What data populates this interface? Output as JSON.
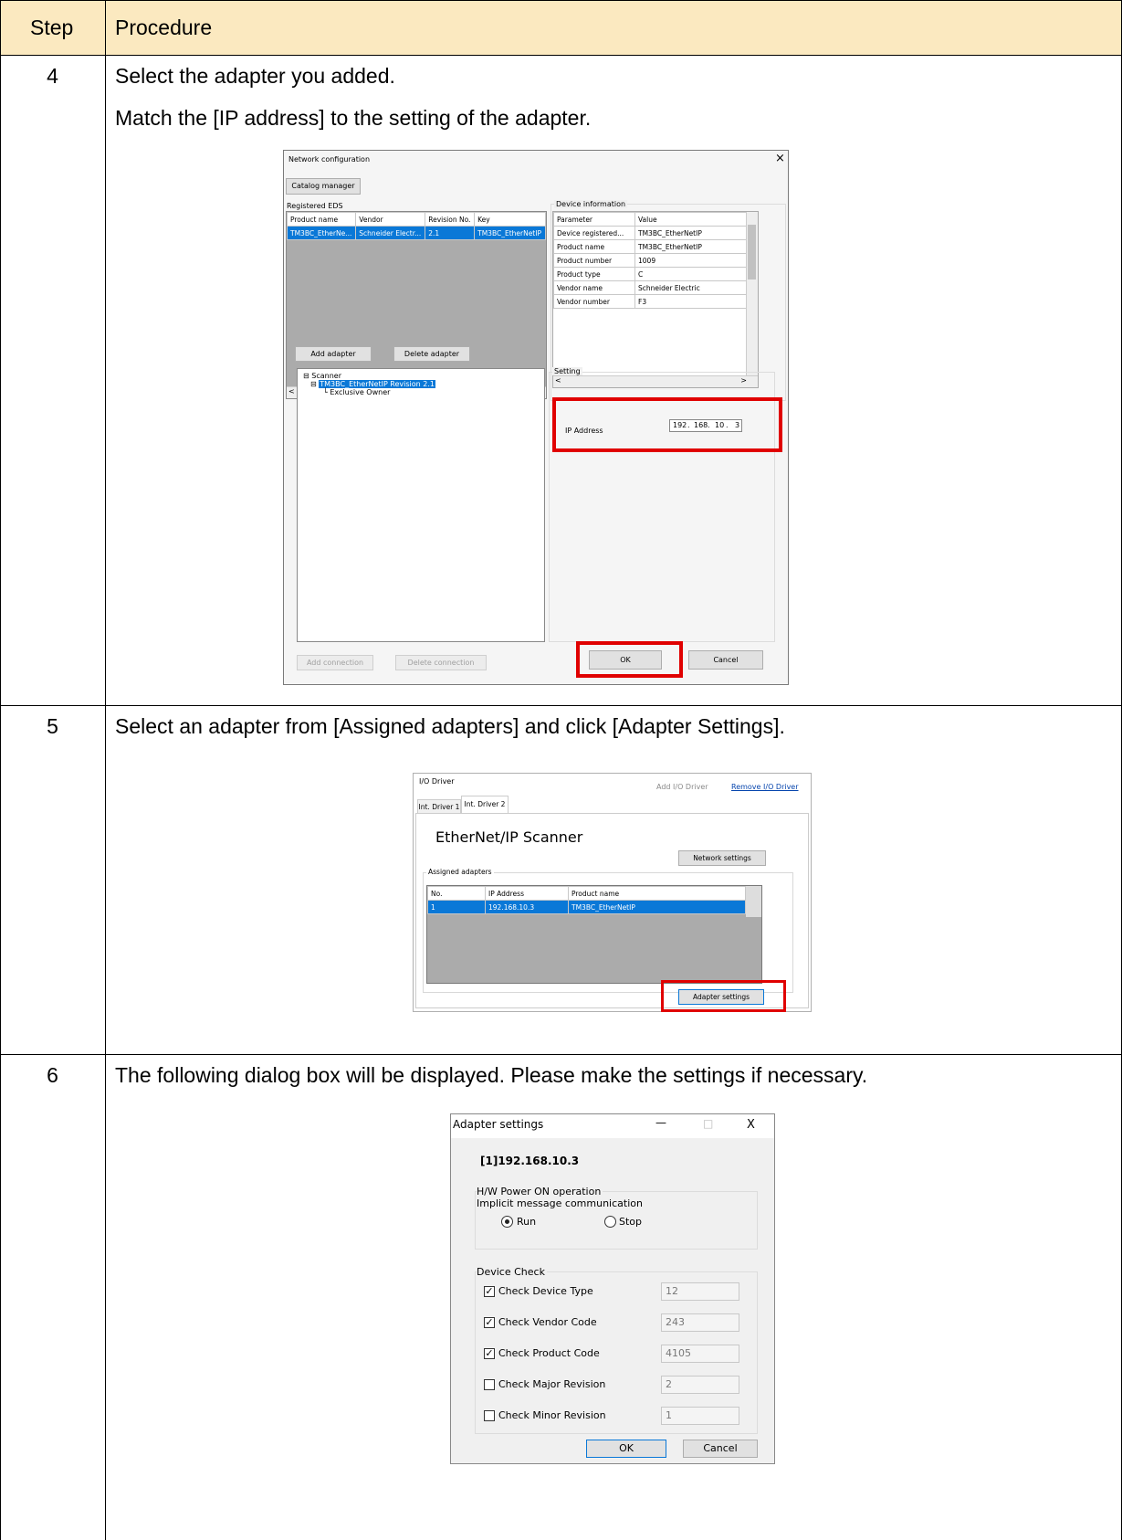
{
  "table": {
    "header": {
      "step": "Step",
      "procedure": "Procedure"
    },
    "rows": [
      {
        "step": "4",
        "lines": [
          "Select the adapter you added.",
          "Match the [IP address] to the setting of the adapter."
        ]
      },
      {
        "step": "5",
        "lines": [
          "Select an adapter from [Assigned adapters] and click [Adapter Settings]."
        ]
      },
      {
        "step": "6",
        "lines": [
          "The following dialog box will be displayed. Please make the settings if necessary."
        ]
      }
    ],
    "header_color": "#fbe9c0"
  },
  "network_config": {
    "title": "Network configuration",
    "close": "×",
    "catalog_manager": "Catalog manager",
    "registered_eds": "Registered EDS",
    "eds_columns": [
      "Product name",
      "Vendor",
      "Revision No.",
      "Key"
    ],
    "eds_row": [
      "TM3BC_EtherNe...",
      "Schneider Electr...",
      "2.1",
      "TM3BC_EtherNetIP"
    ],
    "device_information": "Device information",
    "device_columns": [
      "Parameter",
      "Value"
    ],
    "device_rows": [
      [
        "Device registered...",
        "TM3BC_EtherNetIP"
      ],
      [
        "Product name",
        "TM3BC_EtherNetIP"
      ],
      [
        "Product number",
        "1009"
      ],
      [
        "Product type",
        "C"
      ],
      [
        "Vendor name",
        "Schneider Electric"
      ],
      [
        "Vendor number",
        "F3"
      ]
    ],
    "add_adapter": "Add adapter",
    "delete_adapter": "Delete adapter",
    "setting": "Setting",
    "tree": {
      "root": "Scanner",
      "child": "TM3BC_EtherNetIP Revision 2.1",
      "grandchild": "Exclusive Owner"
    },
    "ip_label": "IP Address",
    "ip_octets": [
      "192",
      "168",
      "10",
      "3"
    ],
    "add_connection": "Add connection",
    "delete_connection": "Delete connection",
    "ok": "OK",
    "cancel": "Cancel"
  },
  "io_driver": {
    "title": "I/O Driver",
    "add_driver": "Add I/O Driver",
    "remove_driver": "Remove I/O Driver",
    "tabs": [
      "Int. Driver 1",
      "Int. Driver 2"
    ],
    "heading": "EtherNet/IP Scanner",
    "network_settings": "Network settings",
    "assigned_adapters": "Assigned adapters",
    "columns": [
      "No.",
      "IP Address",
      "Product name"
    ],
    "rows": [
      [
        "1",
        "192.168.10.3",
        "TM3BC_EtherNetIP"
      ]
    ],
    "adapter_settings": "Adapter settings"
  },
  "adapter_settings": {
    "title": "Adapter settings",
    "minimize": "—",
    "maximize": "□",
    "close": "X",
    "target": "[1]192.168.10.3",
    "hw_group": "H/W Power ON operation",
    "implicit": "Implicit message communication",
    "run": "Run",
    "stop": "Stop",
    "device_check": "Device Check",
    "checks": [
      {
        "label": "Check Device Type",
        "checked": true,
        "value": "12"
      },
      {
        "label": "Check Vendor Code",
        "checked": true,
        "value": "243"
      },
      {
        "label": "Check Product Code",
        "checked": true,
        "value": "4105"
      },
      {
        "label": "Check Major Revision",
        "checked": false,
        "value": "2"
      },
      {
        "label": "Check Minor Revision",
        "checked": false,
        "value": "1"
      }
    ],
    "ok": "OK",
    "cancel": "Cancel"
  }
}
